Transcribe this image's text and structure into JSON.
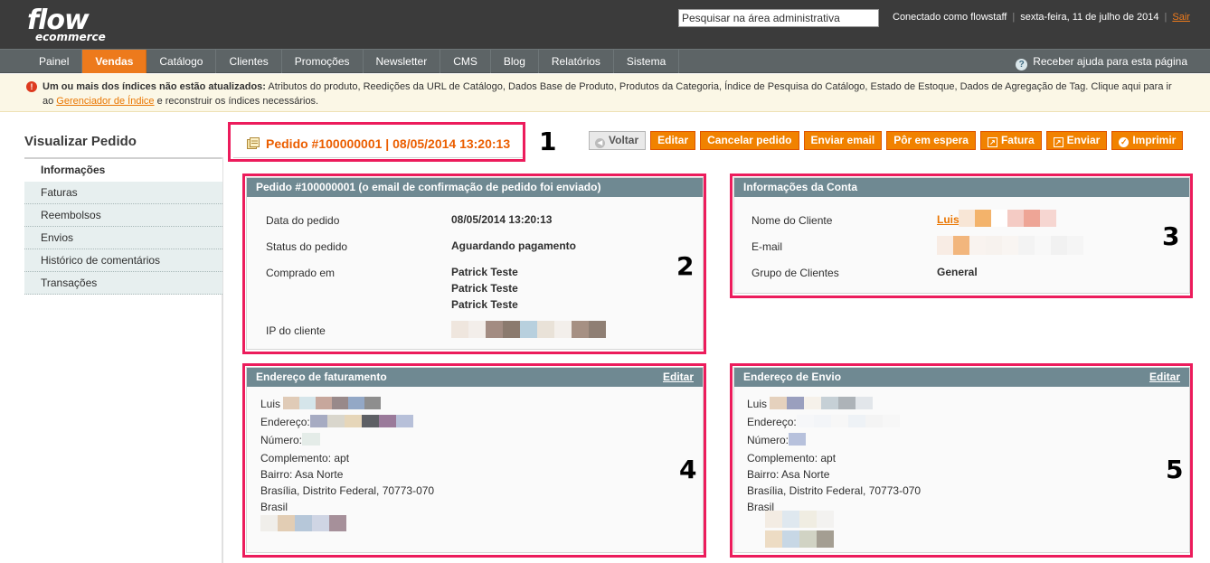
{
  "header": {
    "logo_line1": "flow",
    "logo_line2": "ecommerce",
    "search_placeholder": "Pesquisar na área administrativa",
    "connected": "Conectado como flowstaff",
    "date": "sexta-feira, 11 de julho de 2014",
    "logout": "Sair"
  },
  "nav": {
    "items": [
      "Painel",
      "Vendas",
      "Catálogo",
      "Clientes",
      "Promoções",
      "Newsletter",
      "CMS",
      "Blog",
      "Relatórios",
      "Sistema"
    ],
    "active": "Vendas",
    "help": "Receber ajuda para esta página"
  },
  "notice": {
    "bold": "Um ou mais dos índices não estão atualizados:",
    "text": " Atributos do produto, Reedições da URL de Catálogo, Dados Base de Produto, Produtos da Categoria, Índice de Pesquisa do Catálogo, Estado de Estoque, Dados de Agregação de Tag. Clique aqui para ir ao ",
    "link": "Gerenciador de Índice",
    "tail": " e reconstruir os índices necessários."
  },
  "sidebar": {
    "title": "Visualizar Pedido",
    "tabs": [
      "Informações",
      "Faturas",
      "Reembolsos",
      "Envios",
      "Histórico de comentários",
      "Transações"
    ]
  },
  "page": {
    "title": "Pedido #100000001 | 08/05/2014 13:20:13",
    "buttons": {
      "back": "Voltar",
      "edit": "Editar",
      "cancel": "Cancelar pedido",
      "email": "Enviar email",
      "hold": "Pôr em espera",
      "invoice": "Fatura",
      "ship": "Enviar",
      "print": "Imprimir"
    }
  },
  "order": {
    "header": "Pedido #100000001 (o email de confirmação de pedido foi enviado)",
    "date_label": "Data do pedido",
    "date_value": "08/05/2014 13:20:13",
    "status_label": "Status do pedido",
    "status_value": "Aguardando pagamento",
    "bought_label": "Comprado em",
    "bought_values": [
      "Patrick Teste",
      "Patrick Teste",
      "Patrick Teste"
    ],
    "ip_label": "IP do cliente"
  },
  "account": {
    "header": "Informações da Conta",
    "name_label": "Nome do Cliente",
    "name_value": "Luis",
    "email_label": "E-mail",
    "group_label": "Grupo de Clientes",
    "group_value": "General"
  },
  "billing": {
    "header": "Endereço de faturamento",
    "edit": "Editar",
    "name": "Luis",
    "address_label": "Endereço:",
    "number_label": "Número:",
    "complement": "Complemento: apt",
    "district": "Bairro: Asa Norte",
    "city": "Brasília, Distrito Federal, 70773-070",
    "country": "Brasil"
  },
  "shipping": {
    "header": "Endereço de Envio",
    "edit": "Editar",
    "name": "Luis",
    "address_label": "Endereço:",
    "number_label": "Número:",
    "complement": "Complemento: apt",
    "district": "Bairro: Asa Norte",
    "city": "Brasília, Distrito Federal, 70773-070",
    "country": "Brasil"
  },
  "annotations": [
    "1",
    "2",
    "3",
    "4",
    "5"
  ],
  "colors": {
    "accent": "#ed7a1c",
    "header_bg": "#3b3b3b",
    "box_header": "#6f8992",
    "highlight": "#ec1c5c"
  }
}
